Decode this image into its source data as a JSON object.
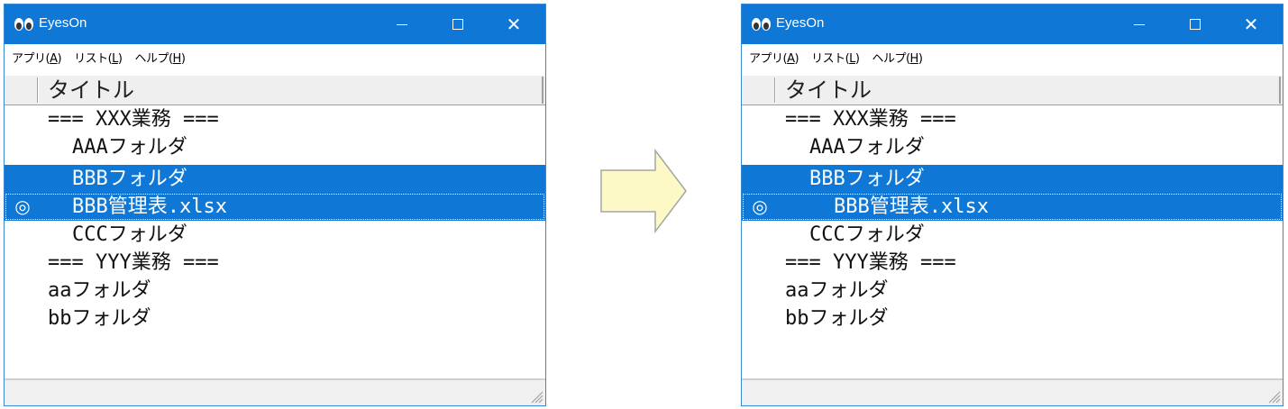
{
  "app_title": "EyesOn",
  "menu": [
    {
      "label": "アプリ(",
      "key": "A",
      "close": ")"
    },
    {
      "label": "リスト(",
      "key": "L",
      "close": ")"
    },
    {
      "label": "ヘルプ(",
      "key": "H",
      "close": ")"
    }
  ],
  "column_header": "タイトル",
  "caption_buttons": {
    "close": "✕"
  },
  "icons": {
    "app": "eyes-icon",
    "selected_mark": "◎",
    "arrow": "right-arrow-icon",
    "grip": "size-grip-icon"
  },
  "colors": {
    "accent": "#0f78d7",
    "arrow_fill": "#fdf9c7",
    "arrow_stroke": "#a5a5a5"
  },
  "left_window": {
    "rows": [
      {
        "text": "=== XXX業務 ==="
      },
      {
        "text": "AAAフォルダ"
      },
      {
        "text": "BBBフォルダ"
      },
      {
        "text": "BBB管理表.xlsx",
        "mark": "◎"
      },
      {
        "text": "CCCフォルダ"
      },
      {
        "text": "=== YYY業務 ==="
      },
      {
        "text": "aaフォルダ"
      },
      {
        "text": "bbフォルダ"
      }
    ]
  },
  "right_window": {
    "rows": [
      {
        "text": "=== XXX業務 ==="
      },
      {
        "text": "AAAフォルダ"
      },
      {
        "text": "BBBフォルダ"
      },
      {
        "text": "BBB管理表.xlsx",
        "mark": "◎"
      },
      {
        "text": "CCCフォルダ"
      },
      {
        "text": "=== YYY業務 ==="
      },
      {
        "text": "aaフォルダ"
      },
      {
        "text": "bbフォルダ"
      }
    ]
  }
}
